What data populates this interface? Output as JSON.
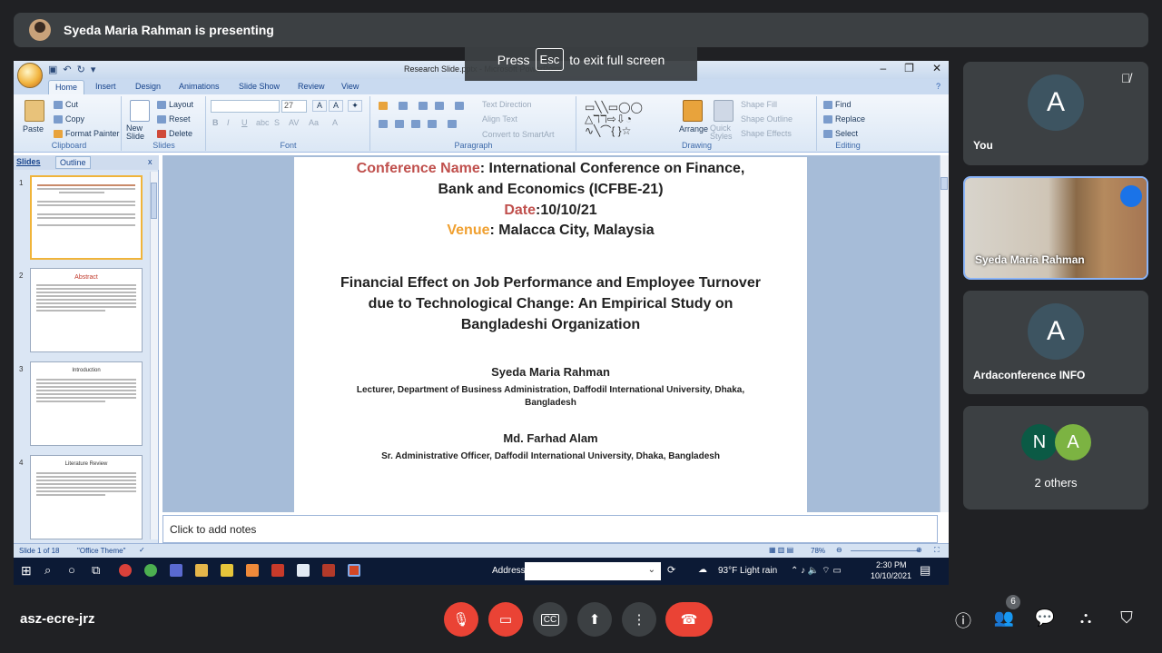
{
  "meet": {
    "presenter_text": "Syeda Maria Rahman is presenting",
    "esc_press": "Press",
    "esc_key": "Esc",
    "esc_exit": "to exit full screen",
    "meeting_code": "asz-ecre-jrz",
    "people_count": "6"
  },
  "participants": {
    "you": {
      "initial": "A",
      "name": "You"
    },
    "presenter": {
      "name": "Syeda Maria Rahman"
    },
    "arda": {
      "initial": "A",
      "name": "Ardaconference INFO"
    },
    "others": {
      "initial1": "N",
      "initial2": "A",
      "label": "2 others"
    }
  },
  "ppt": {
    "window_title": "Research Slide.pptx - Microsoft PowerPoint",
    "tabs": [
      "Home",
      "Insert",
      "Design",
      "Animations",
      "Slide Show",
      "Review",
      "View"
    ],
    "clipboard": {
      "paste": "Paste",
      "cut": "Cut",
      "copy": "Copy",
      "format_painter": "Format Painter",
      "label": "Clipboard"
    },
    "slides_group": {
      "new_slide": "New Slide",
      "layout": "Layout",
      "reset": "Reset",
      "delete": "Delete",
      "label": "Slides"
    },
    "font_group": {
      "size": "27",
      "label": "Font"
    },
    "paragraph_group": {
      "text_direction": "Text Direction",
      "align_text": "Align Text",
      "convert": "Convert to SmartArt",
      "label": "Paragraph"
    },
    "drawing_group": {
      "arrange": "Arrange",
      "quick_styles": "Quick Styles",
      "shape_fill": "Shape Fill",
      "shape_outline": "Shape Outline",
      "shape_effects": "Shape Effects",
      "label": "Drawing"
    },
    "editing_group": {
      "find": "Find",
      "replace": "Replace",
      "select": "Select",
      "label": "Editing"
    },
    "pane_tabs": {
      "slides": "Slides",
      "outline": "Outline"
    },
    "thumbs": [
      {
        "num": "1"
      },
      {
        "num": "2",
        "title": "Abstract"
      },
      {
        "num": "3",
        "title": "Introduction"
      },
      {
        "num": "4",
        "title": "Literature Review"
      }
    ],
    "slide": {
      "conf_label": "Conference Name",
      "conf_value1": ": International Conference on Finance,",
      "conf_value2": "Bank and Economics (ICFBE-21)",
      "date_label": "Date",
      "date_value": ":10/10/21",
      "venue_label": "Venue",
      "venue_value": ": Malacca City, Malaysia",
      "paper_line1": "Financial Effect on Job Performance and Employee Turnover",
      "paper_line2": "due to Technological Change: An Empirical Study on",
      "paper_line3": "Bangladeshi Organization",
      "author1": "Syeda Maria Rahman",
      "affil1_line1": "Lecturer, Department of Business Administration, Daffodil International University, Dhaka,",
      "affil1_line2": "Bangladesh",
      "author2": "Md. Farhad Alam",
      "affil2": "Sr. Administrative Officer, Daffodil International University, Dhaka, Bangladesh"
    },
    "notes_placeholder": "Click to add notes",
    "status": {
      "slide_of": "Slide 1 of 18",
      "theme": "\"Office Theme\"",
      "zoom": "78%"
    }
  },
  "taskbar": {
    "address_label": "Address",
    "weather": "93°F  Light rain",
    "time": "2:30 PM",
    "date": "10/10/2021"
  }
}
